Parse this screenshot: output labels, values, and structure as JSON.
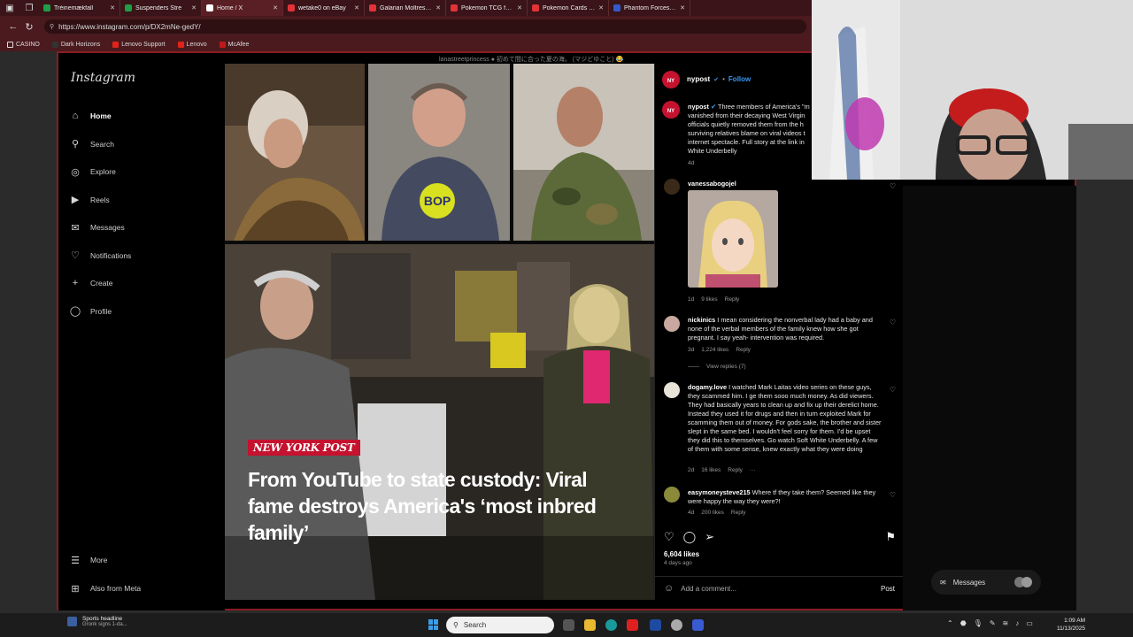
{
  "browser": {
    "tabs": [
      {
        "label": "Tréinemækfall",
        "color": "#1f9e47"
      },
      {
        "label": "Suspenders Stre",
        "color": "#1f9e47"
      },
      {
        "label": "Home / X",
        "color": "#ffffff"
      },
      {
        "label": "wetake0 on eBay",
        "color": "#e33238"
      },
      {
        "label": "Galarian Moltres for",
        "color": "#e33238"
      },
      {
        "label": "Pokemon TCG for sale",
        "color": "#e33238"
      },
      {
        "label": "Pokemon Cards in C",
        "color": "#e33238"
      },
      {
        "label": "Phantom Forces - Rob",
        "color": "#335acc"
      }
    ],
    "url": "https://www.instagram.com/p/DX2mNe-gedY/",
    "bookmarks": [
      "CASINO",
      "Dark Horizons",
      "Lenovo Support",
      "Lenovo",
      "McAfee"
    ]
  },
  "instagram": {
    "logo": "Instagram",
    "nav": [
      {
        "label": "Home",
        "icon": "home-icon"
      },
      {
        "label": "Search",
        "icon": "search-icon"
      },
      {
        "label": "Explore",
        "icon": "compass-icon"
      },
      {
        "label": "Reels",
        "icon": "reels-icon"
      },
      {
        "label": "Messages",
        "icon": "messenger-icon"
      },
      {
        "label": "Notifications",
        "icon": "heart-icon"
      },
      {
        "label": "Create",
        "icon": "plus-icon"
      },
      {
        "label": "Profile",
        "icon": "profile-icon"
      }
    ],
    "more": "More",
    "also_from_meta": "Also from Meta"
  },
  "post": {
    "top_caption": "lanastreetprincess ● 初めて間に合った夏の海。 (マジどゆこと) 😂",
    "brand": "NEW YORK POST",
    "headline": "From YouTube to state custody: Viral fame destroys America's ‘most inbred family’",
    "author": "nypost",
    "follow": "Follow",
    "caption_user": "nypost",
    "caption_lines": [
      "Three members of America's \"m",
      "vanished from their decaying West Virgin",
      "officials quietly removed them from the h",
      "surviving relatives blame on viral videos t",
      "internet spectacle. Full story at the link in",
      "White Underbelly"
    ],
    "caption_age": "4d",
    "likes": "6,604 likes",
    "posted": "4 days ago",
    "add_comment": "Add a comment...",
    "post_btn": "Post"
  },
  "comments": [
    {
      "user": "vanessabogojel",
      "text": "",
      "age": "1d",
      "likes": "9 likes",
      "reply": "Reply"
    },
    {
      "user": "nickinics",
      "text": "I mean considering the nonverbal lady had a baby and none of the verbal members of the family knew how she got pregnant. I say yeah- intervention was required.",
      "age": "3d",
      "likes": "1,224 likes",
      "reply": "Reply",
      "view_replies": "View replies (7)"
    },
    {
      "user": "dogamy.love",
      "text": "I watched Mark Laitas video series on these guys, they scammed him. I ge them sooo much money. As did viewers. They had basically years to clean up and fix up their derelict home. Instead they used it for drugs and then in turn exploited Mark for scamming them out of money. For gods sake, the brother and sister slept in the same bed. I wouldn't feel sorry for them. I'd be upset they did this to themselves. Go watch Soft White Underbelly. A few of them with some sense, knew exactly what they were doing",
      "age": "2d",
      "likes": "16 likes",
      "reply": "Reply",
      "more": "···"
    },
    {
      "user": "easymoneysteve215",
      "text": "Where tf they take them? Seemed like they were happy the way they were?!",
      "age": "4d",
      "likes": "200 likes",
      "reply": "Reply"
    }
  ],
  "messages_pill": "Messages",
  "taskbar": {
    "weather_title": "Sports headline",
    "weather_sub": "Gronk signs 1-da...",
    "search": "Search",
    "time": "1:09 AM",
    "date": "11/13/2025"
  }
}
